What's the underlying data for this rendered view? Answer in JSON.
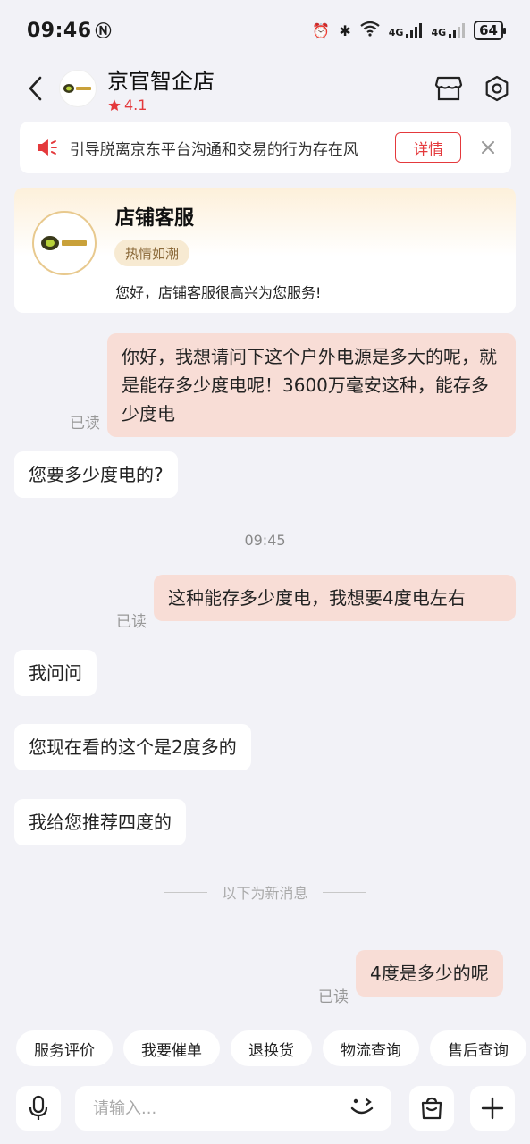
{
  "status_bar": {
    "time": "09:46",
    "battery": "64",
    "net1": "4G",
    "net2": "4G"
  },
  "header": {
    "shop_name": "京官智企店",
    "rating": "4.1",
    "logo_text": "京官智企"
  },
  "notice": {
    "text": "引导脱离京东平台沟通和交易的行为存在风",
    "button": "详情"
  },
  "service_card": {
    "title": "店铺客服",
    "tag": "热情如潮",
    "greeting": "您好，店铺客服很高兴为您服务!"
  },
  "messages": [
    {
      "side": "right",
      "text": "你好，我想请问下这个户外电源是多大的呢，就是能存多少度电呢！3600万毫安这种，能存多少度电",
      "read": "已读"
    },
    {
      "side": "left",
      "text": "您要多少度电的?"
    },
    {
      "side": "right",
      "text": "这种能存多少度电，我想要4度电左右",
      "read": "已读"
    },
    {
      "side": "left",
      "text": "我问问"
    },
    {
      "side": "left",
      "text": "您现在看的这个是2度多的"
    },
    {
      "side": "left",
      "text": "我给您推荐四度的"
    },
    {
      "side": "right",
      "text": "4度是多少的呢",
      "read": "已读"
    }
  ],
  "time_label": "09:45",
  "new_messages_divider": "以下为新消息",
  "quick_replies": [
    "服务评价",
    "我要催单",
    "退换货",
    "物流查询",
    "售后查询"
  ],
  "input": {
    "placeholder": "请输入..."
  },
  "colors": {
    "accent": "#e4393c",
    "bubble_right": "#f8ddd6",
    "background": "#f2f2f7"
  },
  "icons": [
    "back-icon",
    "store-icon",
    "settings-icon",
    "speaker-icon",
    "close-icon",
    "mic-icon",
    "emoji-icon",
    "bag-icon",
    "plus-icon",
    "star-icon"
  ]
}
